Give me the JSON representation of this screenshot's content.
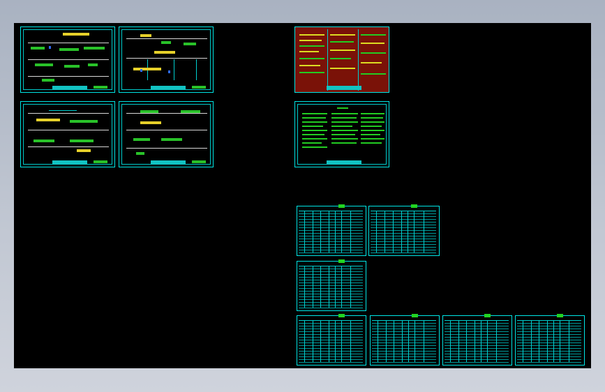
{
  "viewport": {
    "background": "#000000",
    "line_color": "#00e6e6"
  },
  "sheets": [
    {
      "name": "section-sheet-1",
      "kind": "section"
    },
    {
      "name": "section-sheet-2",
      "kind": "section"
    },
    {
      "name": "section-sheet-3",
      "kind": "section"
    },
    {
      "name": "section-sheet-4",
      "kind": "section"
    },
    {
      "name": "legend-sheet",
      "kind": "legend"
    },
    {
      "name": "notes-sheet",
      "kind": "notes"
    },
    {
      "name": "table-sheet-1",
      "kind": "table"
    },
    {
      "name": "table-sheet-2",
      "kind": "table"
    },
    {
      "name": "table-sheet-3",
      "kind": "table"
    },
    {
      "name": "table-sheet-4",
      "kind": "table"
    },
    {
      "name": "table-sheet-5",
      "kind": "table"
    },
    {
      "name": "table-sheet-6",
      "kind": "table"
    },
    {
      "name": "table-sheet-7",
      "kind": "table"
    }
  ]
}
